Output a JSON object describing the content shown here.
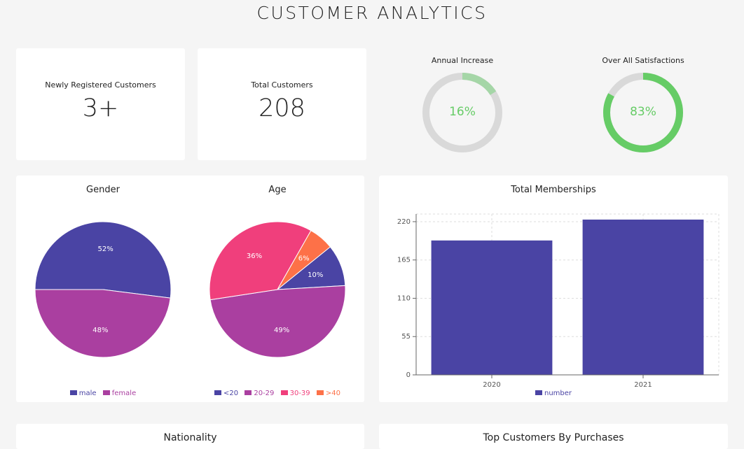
{
  "header": {
    "title": "CUSTOMER ANALYTICS"
  },
  "stats": [
    {
      "label": "Newly Registered Customers",
      "value": "3+"
    },
    {
      "label": "Total Customers",
      "value": "208"
    }
  ],
  "gauges": [
    {
      "label": "Annual Increase",
      "value": 16,
      "value_text": "16%",
      "color": "#a5d6a7",
      "text_color": "#66cc66"
    },
    {
      "label": "Over All Satisfactions",
      "value": 83,
      "value_text": "83%",
      "color": "#66cc66",
      "text_color": "#66cc66"
    }
  ],
  "colors": {
    "track": "#d9d9d9",
    "indigo": "#4a44a4",
    "purple": "#aa3fa0",
    "pink": "#f03f7c",
    "orange": "#fd7148"
  },
  "sections": {
    "nationality_title": "Nationality",
    "top_customers_title": "Top Customers By Purchases"
  },
  "chart_data": [
    {
      "type": "pie",
      "title": "Gender",
      "labels": [
        "male",
        "female"
      ],
      "values": [
        52,
        48
      ],
      "value_labels": [
        "52%",
        "48%"
      ],
      "colors": [
        "#4a44a4",
        "#aa3fa0"
      ],
      "legend": "bottom"
    },
    {
      "type": "pie",
      "title": "Age",
      "labels": [
        "<20",
        "20-29",
        "30-39",
        ">40"
      ],
      "values": [
        10,
        49,
        36,
        6
      ],
      "value_labels": [
        "10%",
        "49%",
        "36%",
        "6%"
      ],
      "colors": [
        "#4a44a4",
        "#aa3fa0",
        "#f03f7c",
        "#fd7148"
      ],
      "legend": "bottom"
    },
    {
      "type": "bar",
      "title": "Total Memberships",
      "categories": [
        "2020",
        "2021"
      ],
      "series": [
        {
          "name": "number",
          "values": [
            193,
            223
          ]
        }
      ],
      "yticks": [
        "0",
        "55",
        "110",
        "165",
        "220"
      ],
      "ylim": [
        0,
        231
      ],
      "grid": true,
      "color": "#4a44a4",
      "legend": "bottom"
    }
  ]
}
